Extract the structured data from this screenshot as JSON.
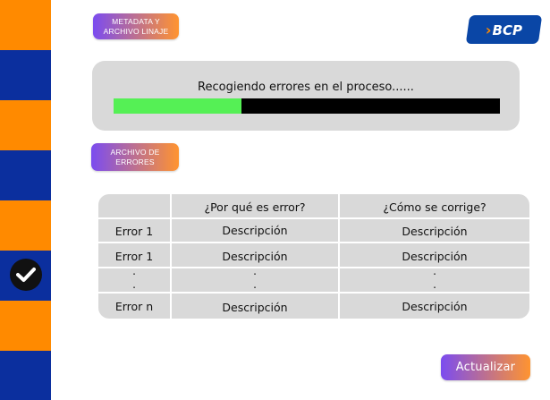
{
  "stepper": {
    "colors": {
      "orange": "#ff8a00",
      "blue": "#0b2f9e",
      "check_bg": "#111111"
    },
    "steps": [
      {
        "color": "orange"
      },
      {
        "color": "blue"
      },
      {
        "color": "orange"
      },
      {
        "color": "blue"
      },
      {
        "color": "orange"
      },
      {
        "color": "blue",
        "icon": "check-circle-icon",
        "completed": true
      },
      {
        "color": "orange"
      },
      {
        "color": "blue"
      }
    ]
  },
  "buttons": {
    "metadata_label": "METADATA Y ARCHIVO LINAJE",
    "errores_label": "ARCHIVO DE ERRORES",
    "actualizar_label": "Actualizar"
  },
  "logo": {
    "text": "BCP",
    "icon": "bcp-chevron-icon",
    "colors": {
      "bg": "#0a46a6",
      "accent": "#ff8a00"
    }
  },
  "progress": {
    "label": "Recogiendo errores en el proceso......",
    "fraction": 0.33,
    "colors": {
      "fill": "#55f055",
      "track": "#000000"
    }
  },
  "table": {
    "headers": [
      "",
      "¿Por qué es error?",
      "¿Cómo se corrige?"
    ],
    "rows": [
      [
        "Error 1",
        "Descripción",
        "Descripción"
      ],
      [
        "Error 1",
        "Descripción",
        "Descripción"
      ],
      [
        ".",
        ".",
        "."
      ],
      [
        ".",
        ".",
        "."
      ],
      [
        "Error n",
        "Descripción",
        "Descripción"
      ]
    ]
  },
  "accent_colors": {
    "gradient_start": "#7b4cf0",
    "gradient_end": "#ff9430",
    "panel": "#d9d9d9"
  }
}
